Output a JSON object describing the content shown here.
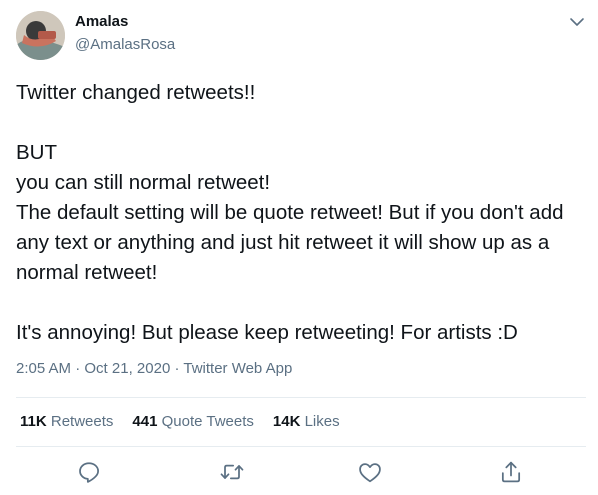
{
  "author": {
    "name": "Amalas",
    "handle": "@AmalasRosa"
  },
  "tweet": {
    "text": "Twitter changed retweets!!\n\nBUT\nyou can still normal retweet!\nThe default setting will be quote retweet! But if you don't add any text or anything and just hit retweet it will show up as a normal retweet!\n\nIt's annoying! But please keep retweeting! For artists :D",
    "time": "2:05 AM",
    "separator1": " · ",
    "date": "Oct 21, 2020",
    "separator2": " · ",
    "source": "Twitter Web App"
  },
  "stats": {
    "retweets_count": "11K",
    "retweets_label": " Retweets",
    "quote_count": "441",
    "quote_label": " Quote Tweets",
    "likes_count": "14K",
    "likes_label": " Likes"
  },
  "icons": {
    "menu": "chevron-down-icon",
    "reply": "reply-icon",
    "retweet": "retweet-icon",
    "like": "heart-icon",
    "share": "share-icon"
  },
  "colors": {
    "secondary_text": "#5b7083",
    "divider": "#e6ecf0"
  }
}
